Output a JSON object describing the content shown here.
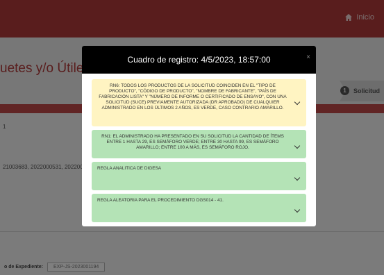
{
  "topbar": {
    "home_label": "Inicio"
  },
  "background": {
    "page_title": "uetes y/o Útiles de",
    "step": {
      "number": "1",
      "label": "Solicitud"
    },
    "text_1": "1",
    "text_2": "21003683, 2022000531, 202200",
    "expediente_label": "o de Expediente:",
    "expediente_value": "EXP-JS-2023001194"
  },
  "modal": {
    "title": "Cuadro de registro: 4/5/2023, 18:57:00",
    "close_label": "×",
    "rules": [
      {
        "text": "RN6: TODOS LOS PRODUCTOS DE LA SOLICITUD COINCIDEN EN EL \"TIPO DE PRODUCTO\", \"CÓDIGO DE PRODUCTO\", \"NOMBRE DE FABRICANTE\", \"PAÍS DE FABRICACIÓN LISTA\" Y \"NÚMERO DE INFORME O CERTIFICADO DE ENSAYO\", CON UNA SOLICITUD (SUCE) PREVIAMENTE AUTORIZADA (DR APROBADO) DE CUALQUIER ADMINISTRADO EN LOS ÚLTIMOS 2 AÑOS, ES VERDE, CASO CONTRARIO AMARILLO.",
        "color": "#fff4c2"
      },
      {
        "text": "RN1: EL ADMINISTRADO HA PRESENTADO EN SU SOLICITUD LA CANTIDAD DE ÍTEMS ENTRE 1 HASTA 29, ES SEMÁFORO VERDE; ENTRE 30 HASTA 99, ES SEMÁFORO AMARILLO; ENTRE 100 A MÁS, ES SEMÁFORO ROJO.",
        "color": "#b4e3b6"
      },
      {
        "text": "REGLA ANALITICA DE DIGESA",
        "color": "#b4e3b6"
      },
      {
        "text": "REGLA ALEATORIA PARA EL PROCEDIMIENTO DGS014 - 41.",
        "color": "#b4e3b6"
      }
    ]
  },
  "colors": {
    "brand_red": "#b23b3b",
    "rule_yellow": "#fff4c2",
    "rule_green": "#b4e3b6"
  }
}
